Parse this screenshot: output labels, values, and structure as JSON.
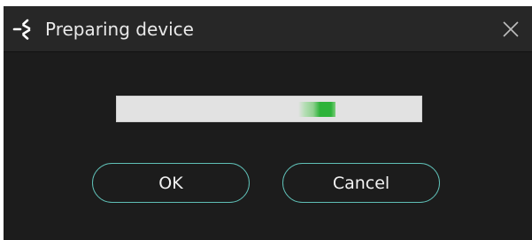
{
  "dialog": {
    "title": "Preparing device",
    "icons": {
      "app": "app-logo-icon",
      "close": "close-icon"
    },
    "progress": {
      "state": "indeterminate",
      "color": "#2eb33a"
    },
    "buttons": {
      "ok_label": "OK",
      "cancel_label": "Cancel"
    },
    "colors": {
      "background": "#1c1c1c",
      "titlebar": "#272727",
      "button_border": "#5fbfb6",
      "progress_track": "#e2e2e2"
    }
  }
}
